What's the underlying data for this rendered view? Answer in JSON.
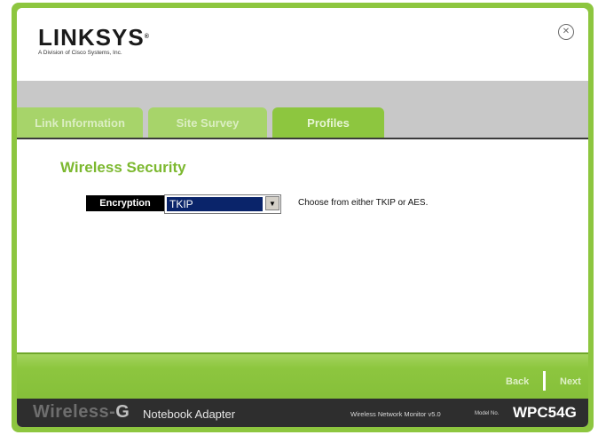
{
  "header": {
    "logo_word": "LINKSYS",
    "logo_registered": "®",
    "logo_subtitle": "A Division of Cisco Systems, Inc.",
    "close_symbol": "✕"
  },
  "tabs": [
    {
      "label": "Link Information"
    },
    {
      "label": "Site Survey"
    },
    {
      "label": "Profiles"
    }
  ],
  "main": {
    "section_title": "Wireless Security",
    "encryption_label": "Encryption",
    "encryption_value": "TKIP",
    "encryption_help": "Choose from either TKIP or AES."
  },
  "nav": {
    "back_label": "Back",
    "next_label": "Next"
  },
  "footer": {
    "brand_wireless": "Wireless-",
    "brand_g": "G",
    "product": "Notebook Adapter",
    "monitor": "Wireless Network Monitor v5.0",
    "model_label": "Model No.",
    "model_number": "WPC54G"
  },
  "colors": {
    "accent_green": "#8dc63f",
    "title_green": "#7cb82f",
    "footer_bg": "#2e2e2e"
  }
}
